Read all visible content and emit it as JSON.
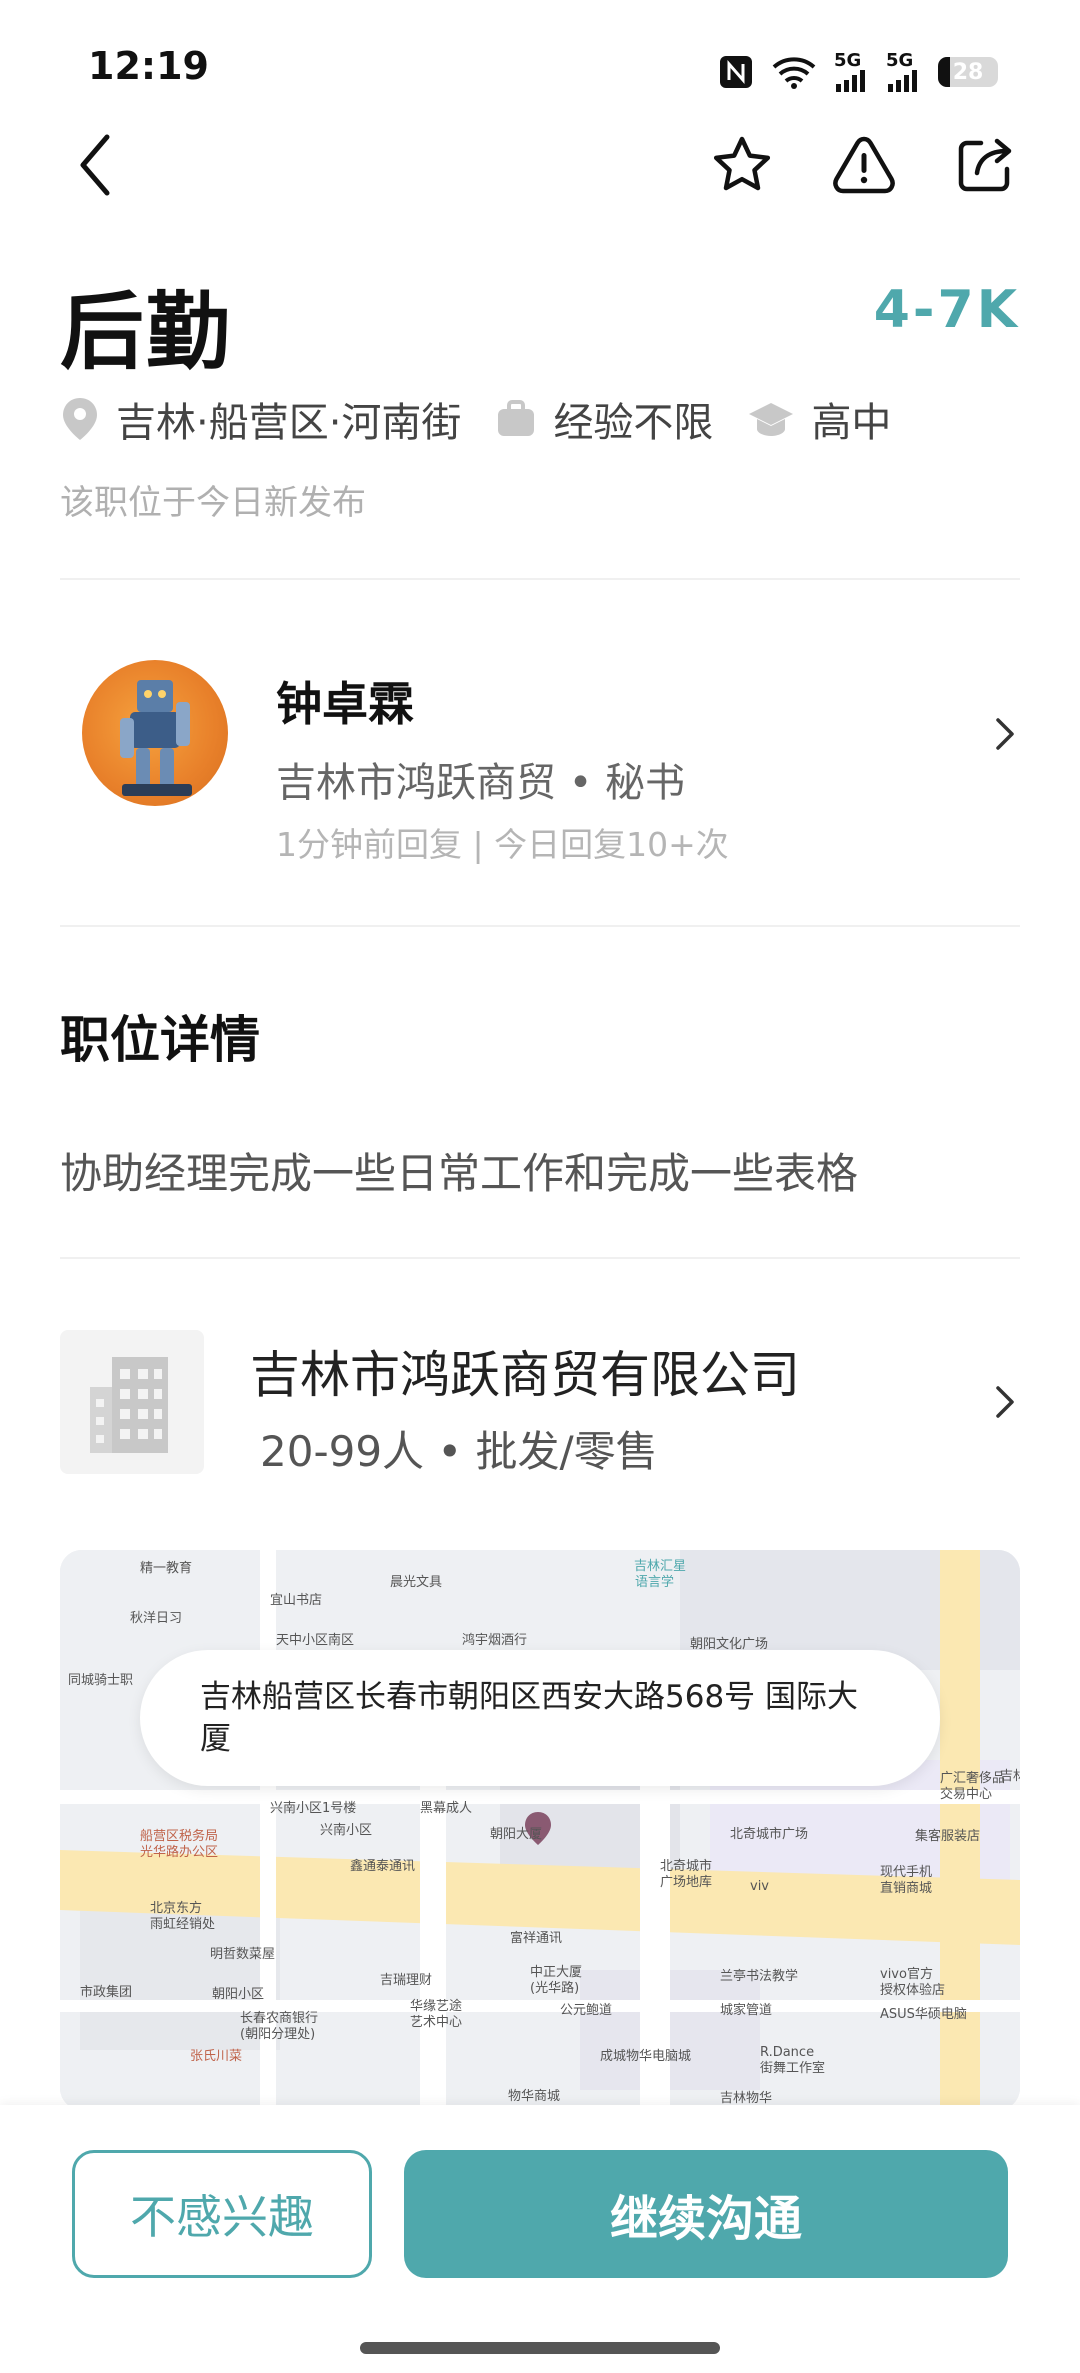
{
  "status_bar": {
    "time": "12:19",
    "battery": "28",
    "network_a": "5G",
    "network_b": "5G"
  },
  "job": {
    "title": "后勤",
    "salary": "4-7K",
    "location": "吉林·船营区·河南街",
    "experience": "经验不限",
    "education": "高中",
    "new_note": "该职位于今日新发布"
  },
  "recruiter": {
    "name": "钟卓霖",
    "company_role": "吉林市鸿跃商贸 • 秘书",
    "reply_info": "1分钟前回复 | 今日回复10+次"
  },
  "details": {
    "section_title": "职位详情",
    "description": "协助经理完成一些日常工作和完成一些表格"
  },
  "company": {
    "name": "吉林市鸿跃商贸有限公司",
    "meta": "20-99人 • 批发/零售"
  },
  "map": {
    "address": "吉林船营区长春市朝阳区西安大路568号   国际大厦",
    "labels": [
      "精一教育",
      "晨光文具",
      "吉林汇星语言学",
      "宜山书店",
      "秋洋日习",
      "天中小区南区",
      "鸿宇烟酒行",
      "朝阳文化广场",
      "同城骑士职",
      "兴南小区1号楼",
      "黑幕成人",
      "船营区税务局光华路办公区",
      "兴南小区",
      "鑫通泰通讯",
      "北奇城市广场",
      "广汇奢侈品交易中心",
      "集客服装店",
      "北京东方雨虹经销处",
      "明哲数菜屋",
      "富祥通讯",
      "北奇城市广场地库",
      "viv",
      "现代手机直销商城",
      "吉林大街",
      "市政集团",
      "朝阳小区",
      "吉瑞理财",
      "中正大厦(光华路)",
      "兰亭书法教学",
      "vivo官方授权体验店",
      "长春农商银行(朝阳分理处)",
      "华缘艺途艺术中心",
      "公元鲍道",
      "城家管道",
      "ASUS华硕电脑",
      "张氏川菜",
      "成城物华电脑城",
      "R.Dance街舞工作室",
      "物华商城",
      "吉林物华",
      "朝阳大厦"
    ]
  },
  "actions": {
    "not_interested": "不感兴趣",
    "continue_chat": "继续沟通"
  },
  "colors": {
    "accent": "#4fa8ac",
    "text_primary": "#111111",
    "text_secondary": "#666666",
    "text_muted": "#b0b0b0"
  }
}
